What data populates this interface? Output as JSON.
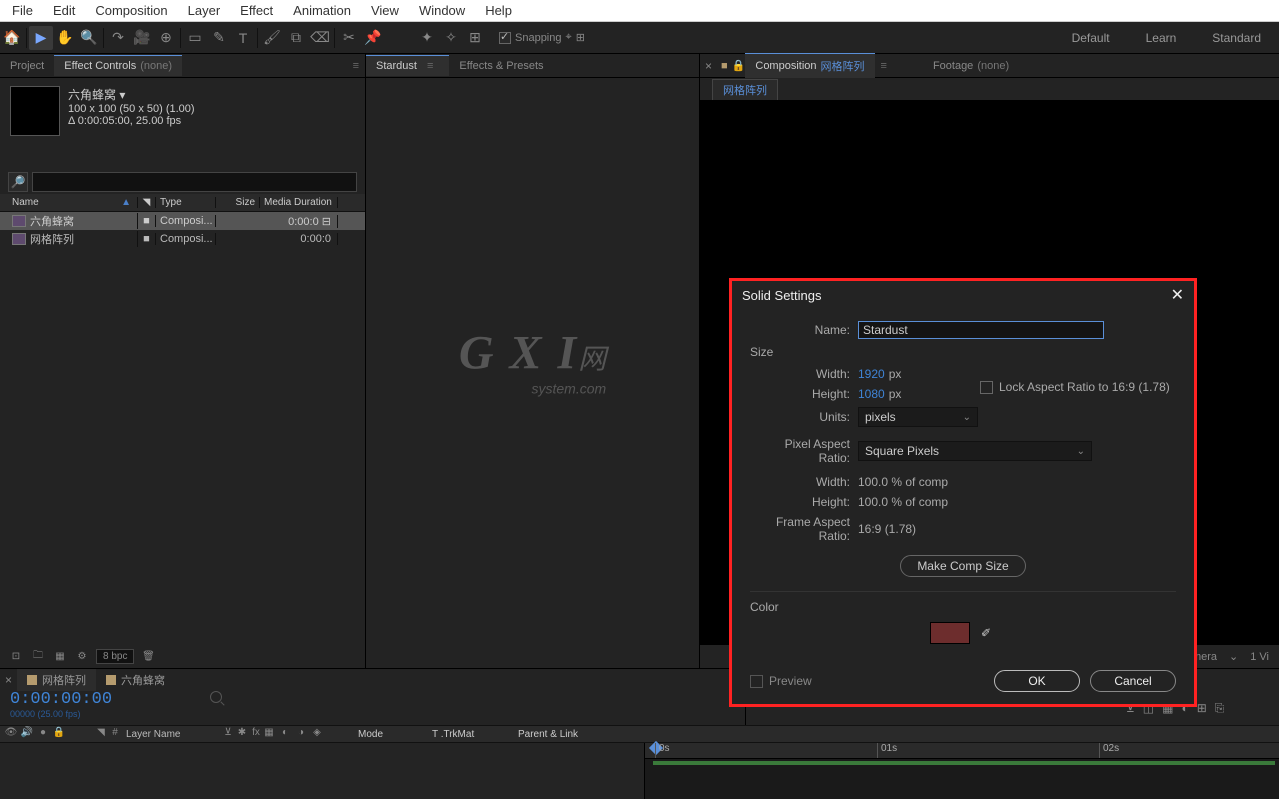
{
  "menu": {
    "items": [
      "File",
      "Edit",
      "Composition",
      "Layer",
      "Effect",
      "Animation",
      "View",
      "Window",
      "Help"
    ]
  },
  "toolbar": {
    "snap_label": "Snapping"
  },
  "workspaces": {
    "items": [
      "Default",
      "Learn",
      "Standard"
    ]
  },
  "project": {
    "tab_project": "Project",
    "tab_effect_controls": "Effect Controls",
    "tab_effect_controls_suffix": "(none)",
    "info": {
      "title": "六角蜂窝 ▾",
      "dims": "100 x 100  (50 x 50)  (1.00)",
      "dur": "Δ 0:00:05:00, 25.00 fps"
    },
    "columns": {
      "name": "Name",
      "type": "Type",
      "size": "Size",
      "dur": "Media Duration"
    },
    "rows": [
      {
        "name": "六角蜂窝",
        "type": "Composi...",
        "dur": "0:00:0",
        "sel": true,
        "children": true
      },
      {
        "name": "网格阵列",
        "type": "Composi...",
        "dur": "0:00:0",
        "sel": false,
        "children": false
      }
    ],
    "bpc": "8 bpc"
  },
  "stardust_panel": {
    "tab": "Stardust",
    "presets": "Effects & Presets"
  },
  "watermark": {
    "big": "G X I",
    "small": "system.com",
    "suffix": "网"
  },
  "comp": {
    "tab_composition": "Composition",
    "active_comp": "网格阵列",
    "footage": "Footage",
    "footage_suffix": "(none)",
    "subtab": "网格阵列",
    "footer": {
      "camera": "mera",
      "views": "1 Vi"
    }
  },
  "timeline": {
    "tabs": [
      {
        "label": "网格阵列",
        "active": true
      },
      {
        "label": "六角蜂窝",
        "active": false
      }
    ],
    "timecode": "0:00:00:00",
    "frameinfo": "00000 (25.00 fps)",
    "layer_name": "Layer Name",
    "mode": "Mode",
    "trkmat": "T .TrkMat",
    "parent": "Parent & Link",
    "marks": [
      "0s",
      "01s",
      "02s"
    ]
  },
  "dialog": {
    "title": "Solid Settings",
    "name_label": "Name:",
    "name_value": "Stardust",
    "size_label": "Size",
    "width_label": "Width:",
    "width_value": "1920",
    "height_label": "Height:",
    "height_value": "1080",
    "px": "px",
    "lock_label": "Lock Aspect Ratio to 16:9 (1.78)",
    "units_label": "Units:",
    "units_value": "pixels",
    "par_label": "Pixel Aspect Ratio:",
    "par_value": "Square Pixels",
    "width_pct_label": "Width:",
    "width_pct_value": "100.0 % of comp",
    "height_pct_label": "Height:",
    "height_pct_value": "100.0 % of comp",
    "farl_label": "Frame Aspect Ratio:",
    "farl_value": "16:9 (1.78)",
    "make_comp": "Make Comp Size",
    "color_label": "Color",
    "preview": "Preview",
    "ok": "OK",
    "cancel": "Cancel"
  }
}
